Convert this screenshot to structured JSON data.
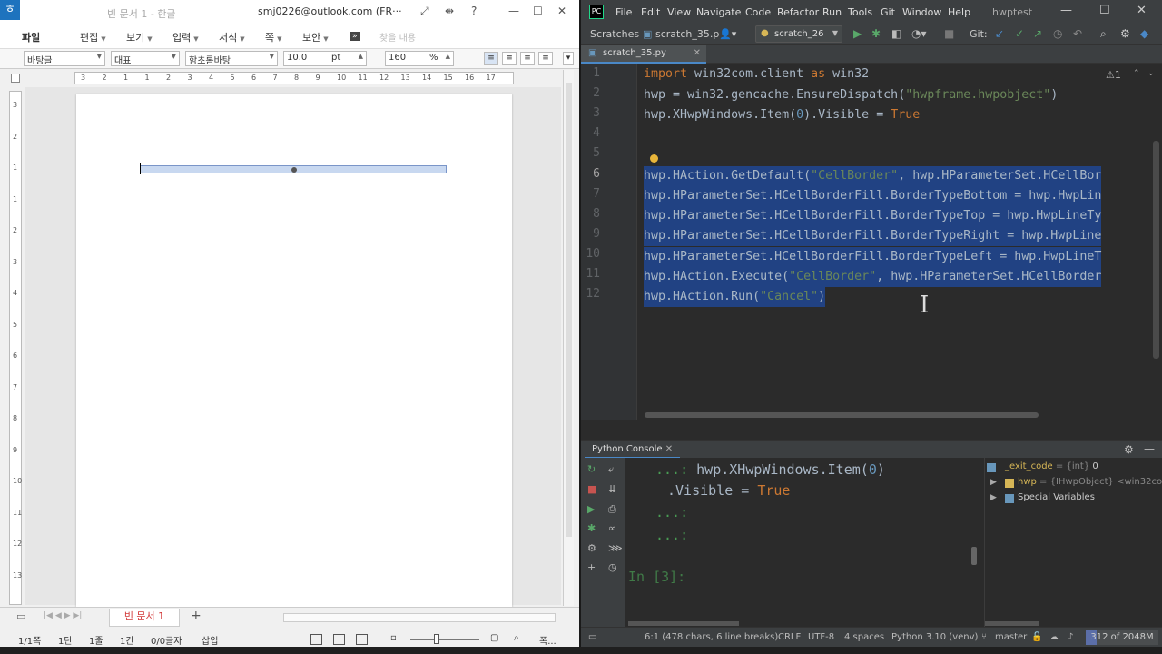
{
  "hwp": {
    "logo": "ㅎ",
    "doc_title": "빈 문서 1 - 한글",
    "account": "smj0226@outlook.com (FR···",
    "title_buttons": [
      "⤢",
      "⇹",
      "?",
      "—",
      "☐",
      "✕"
    ],
    "menu": [
      "파일",
      "편집",
      "보기",
      "입력",
      "서식",
      "쪽",
      "보안"
    ],
    "menu_more": "»",
    "search_placeholder": "찾을 내용",
    "format": {
      "style": "바탕글",
      "lang": "대표",
      "font": "함초롬바탕",
      "size": "10.0",
      "size_unit": "pt",
      "zoom": "160",
      "zoom_unit": "%"
    },
    "ruler_numbers": [
      "3",
      "2",
      "1",
      "1",
      "2",
      "3",
      "4",
      "5",
      "6",
      "7",
      "8",
      "9",
      "10",
      "11",
      "12",
      "13",
      "14",
      "15",
      "16",
      "17"
    ],
    "vruler_numbers": [
      "3",
      "2",
      "1",
      "1",
      "2",
      "3",
      "4",
      "5",
      "6",
      "7",
      "8",
      "9",
      "10",
      "11",
      "12",
      "13"
    ],
    "doc_tab": "빈 문서 1",
    "add_tab": "+",
    "status": {
      "page": "1/1쪽",
      "section": "1단",
      "line": "1줄",
      "col": "1칸",
      "chars": "0/0글자",
      "mode": "삽입",
      "zoom_label": "폭..."
    }
  },
  "ide": {
    "logo": "PC",
    "menu": [
      "File",
      "Edit",
      "View",
      "Navigate",
      "Code",
      "Refactor",
      "Run",
      "Tools",
      "Git",
      "Window",
      "Help"
    ],
    "project": "hwptest",
    "window_buttons": [
      "—",
      "☐",
      "✕"
    ],
    "breadcrumb_root": "Scratches",
    "breadcrumb_file": "scratch_35.p",
    "run_config": "scratch_26",
    "git_label": "Git:",
    "file_tab": "scratch_35.py",
    "warning_count": "⚠1",
    "line_numbers": [
      "1",
      "2",
      "3",
      "4",
      "5",
      "6",
      "7",
      "8",
      "9",
      "10",
      "11",
      "12"
    ],
    "code": {
      "l1_kw": "import",
      "l1_rest": " win32com.client ",
      "l1_as": "as",
      "l1_alias": " win32",
      "l2_a": "hwp = win32.gencache.EnsureDispatch(",
      "l2_str": "\"hwpframe.hwpobject\"",
      "l2_b": ")",
      "l3_a": "hwp.XHwpWindows.Item(",
      "l3_num": "0",
      "l3_b": ").Visible = ",
      "l3_kw": "True",
      "l6_a": "hwp.HAction.GetDefault(",
      "l6_str": "\"CellBorder\"",
      "l6_b": ", hwp.HParameterSet.HCellBor",
      "l7": "hwp.HParameterSet.HCellBorderFill.BorderTypeBottom = hwp.HwpLin",
      "l8": "hwp.HParameterSet.HCellBorderFill.BorderTypeTop = hwp.HwpLineTy",
      "l9": "hwp.HParameterSet.HCellBorderFill.BorderTypeRight = hwp.HwpLine",
      "l10": "hwp.HParameterSet.HCellBorderFill.BorderTypeLeft = hwp.HwpLineT",
      "l11_a": "hwp.HAction.Execute(",
      "l11_str": "\"CellBorder\"",
      "l11_b": ", hwp.HParameterSet.HCellBorder",
      "l12_a": "hwp.HAction.Run(",
      "l12_str": "\"Cancel\"",
      "l12_b": ")"
    },
    "console": {
      "tab": "Python Console",
      "line1_prompt": "...:",
      "line1": " hwp.XHwpWindows.Item(",
      "line1_num": "0",
      "line1_b": ")",
      "line2": ".Visible = ",
      "line2_kw": "True",
      "line3": "...:",
      "line4": "...:",
      "in_prompt": "In [3]:"
    },
    "variables": [
      {
        "name": "_exit_code",
        "type": " = {int} ",
        "value": "0"
      },
      {
        "name": "hwp",
        "type": " = {IHwpObject} ",
        "value": "<win32com"
      },
      {
        "name": "Special Variables",
        "type": "",
        "value": ""
      }
    ],
    "status": {
      "position": "6:1 (478 chars, 6 line breaks)",
      "line_sep": "CRLF",
      "encoding": "UTF-8",
      "indent": "4 spaces",
      "interpreter": "Python 3.10 (venv)",
      "branch": "master",
      "memory_used": 312,
      "memory_total": 2048,
      "memory_label": "312 of 2048M"
    },
    "colors": {
      "selection": "#214283",
      "keyword": "#cc7832",
      "string": "#6a8759",
      "number": "#6897bb"
    }
  }
}
